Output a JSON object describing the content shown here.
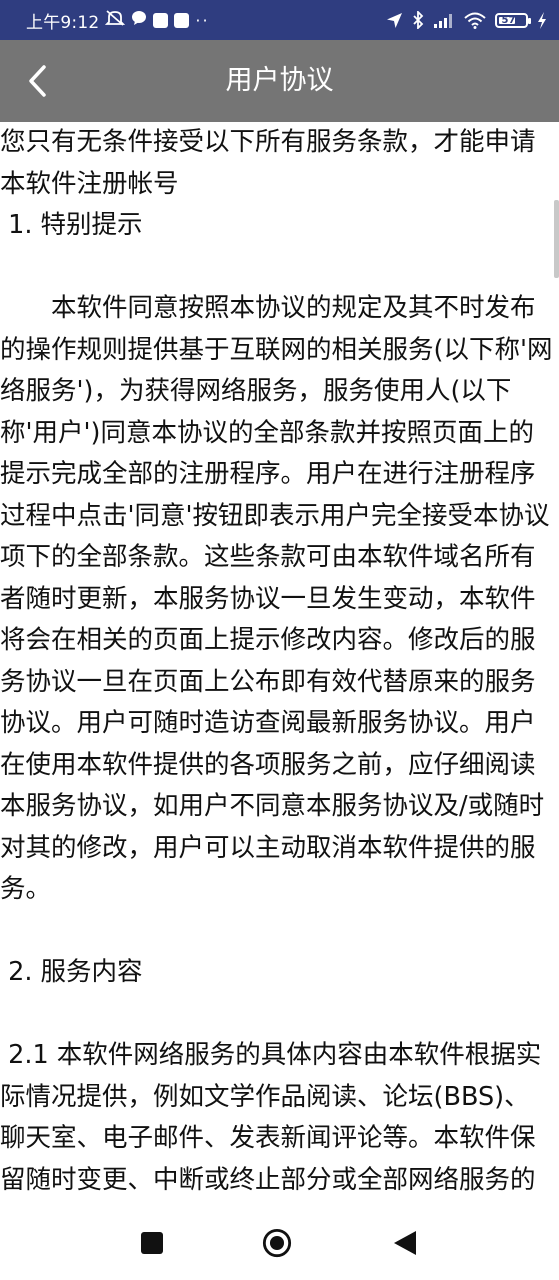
{
  "status_bar": {
    "time": "上午9:12",
    "battery_level": "57",
    "icons": [
      "mute-icon",
      "chat-icon",
      "app-icon",
      "app-icon",
      "more-dots",
      "location-icon",
      "bluetooth-icon",
      "signal-icon",
      "wifi-icon",
      "battery-icon",
      "charging-icon"
    ],
    "dots": "··"
  },
  "app_bar": {
    "title": "用户协议",
    "back_icon": "chevron-left-icon",
    "background": "#757575"
  },
  "content": {
    "intro": "您只有无条件接受以下所有服务条款，才能申请本软件注册帐号",
    "section1_heading": " 1. 特别提示",
    "section1_body": "　　本软件同意按照本协议的规定及其不时发布的操作规则提供基于互联网的相关服务(以下称'网络服务')，为获得网络服务，服务使用人(以下称'用户')同意本协议的全部条款并按照页面上的提示完成全部的注册程序。用户在进行注册程序过程中点击'同意'按钮即表示用户完全接受本协议项下的全部条款。这些条款可由本软件域名所有者随时更新，本服务协议一旦发生变动，本软件将会在相关的页面上提示修改内容。修改后的服务协议一旦在页面上公布即有效代替原来的服务协议。用户可随时造访查阅最新服务协议。用户在使用本软件提供的各项服务之前，应仔细阅读本服务协议，如用户不同意本服务协议及/或随时对其的修改，用户可以主动取消本软件提供的服务。",
    "section2_heading": " 2. 服务内容",
    "section2_1_body": " 2.1 本软件网络服务的具体内容由本软件根据实际情况提供，例如文学作品阅读、论坛(BBS)、聊天室、电子邮件、发表新闻评论等。本软件保留随时变更、中断或终止部分或全部网络服务的权利。"
  },
  "nav_bar": {
    "recents_icon": "square-icon",
    "home_icon": "circle-icon",
    "back_icon": "triangle-back-icon"
  }
}
